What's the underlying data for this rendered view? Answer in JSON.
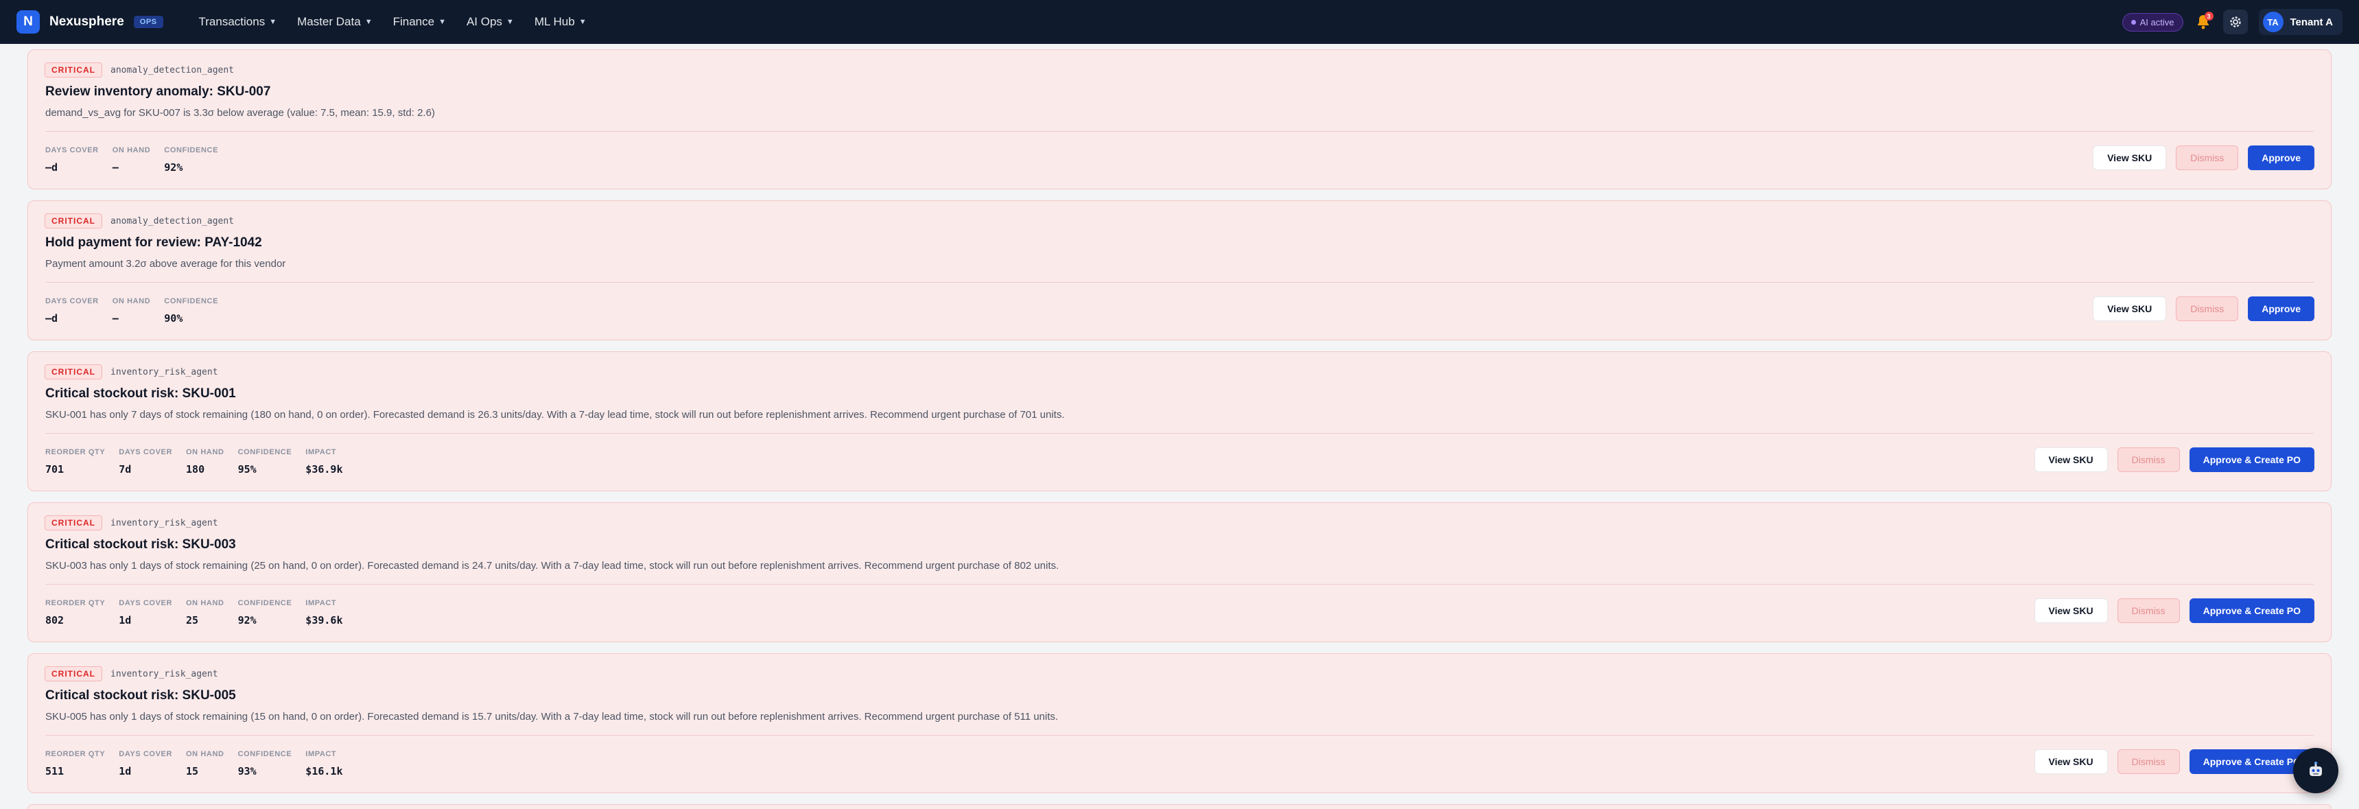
{
  "app": {
    "logo_letter": "N",
    "name": "Nexusphere",
    "env_badge": "OPS"
  },
  "nav": [
    {
      "label": "Transactions"
    },
    {
      "label": "Master Data"
    },
    {
      "label": "Finance"
    },
    {
      "label": "AI Ops"
    },
    {
      "label": "ML Hub"
    }
  ],
  "header_right": {
    "ai_status": "AI active",
    "notification_count": "3",
    "tenant_initials": "TA",
    "tenant_name": "Tenant A"
  },
  "cards": [
    {
      "severity": "CRITICAL",
      "agent": "anomaly_detection_agent",
      "title": "Review inventory anomaly: SKU-007",
      "description": "demand_vs_avg for SKU-007 is 3.3σ below average (value: 7.5, mean: 15.9, std: 2.6)",
      "metrics": [
        {
          "label": "DAYS COVER",
          "value": "—d"
        },
        {
          "label": "ON HAND",
          "value": "—"
        },
        {
          "label": "CONFIDENCE",
          "value": "92%"
        }
      ],
      "actions": {
        "view": "View SKU",
        "dismiss": "Dismiss",
        "approve": "Approve"
      }
    },
    {
      "severity": "CRITICAL",
      "agent": "anomaly_detection_agent",
      "title": "Hold payment for review: PAY-1042",
      "description": "Payment amount 3.2σ above average for this vendor",
      "metrics": [
        {
          "label": "DAYS COVER",
          "value": "—d"
        },
        {
          "label": "ON HAND",
          "value": "—"
        },
        {
          "label": "CONFIDENCE",
          "value": "90%"
        }
      ],
      "actions": {
        "view": "View SKU",
        "dismiss": "Dismiss",
        "approve": "Approve"
      }
    },
    {
      "severity": "CRITICAL",
      "agent": "inventory_risk_agent",
      "title": "Critical stockout risk: SKU-001",
      "description": "SKU-001 has only 7 days of stock remaining (180 on hand, 0 on order). Forecasted demand is 26.3 units/day. With a 7-day lead time, stock will run out before replenishment arrives. Recommend urgent purchase of 701 units.",
      "metrics": [
        {
          "label": "REORDER QTY",
          "value": "701"
        },
        {
          "label": "DAYS COVER",
          "value": "7d"
        },
        {
          "label": "ON HAND",
          "value": "180"
        },
        {
          "label": "CONFIDENCE",
          "value": "95%"
        },
        {
          "label": "IMPACT",
          "value": "$36.9k"
        }
      ],
      "actions": {
        "view": "View SKU",
        "dismiss": "Dismiss",
        "approve": "Approve & Create PO"
      }
    },
    {
      "severity": "CRITICAL",
      "agent": "inventory_risk_agent",
      "title": "Critical stockout risk: SKU-003",
      "description": "SKU-003 has only 1 days of stock remaining (25 on hand, 0 on order). Forecasted demand is 24.7 units/day. With a 7-day lead time, stock will run out before replenishment arrives. Recommend urgent purchase of 802 units.",
      "metrics": [
        {
          "label": "REORDER QTY",
          "value": "802"
        },
        {
          "label": "DAYS COVER",
          "value": "1d"
        },
        {
          "label": "ON HAND",
          "value": "25"
        },
        {
          "label": "CONFIDENCE",
          "value": "92%"
        },
        {
          "label": "IMPACT",
          "value": "$39.6k"
        }
      ],
      "actions": {
        "view": "View SKU",
        "dismiss": "Dismiss",
        "approve": "Approve & Create PO"
      }
    },
    {
      "severity": "CRITICAL",
      "agent": "inventory_risk_agent",
      "title": "Critical stockout risk: SKU-005",
      "description": "SKU-005 has only 1 days of stock remaining (15 on hand, 0 on order). Forecasted demand is 15.7 units/day. With a 7-day lead time, stock will run out before replenishment arrives. Recommend urgent purchase of 511 units.",
      "metrics": [
        {
          "label": "REORDER QTY",
          "value": "511"
        },
        {
          "label": "DAYS COVER",
          "value": "1d"
        },
        {
          "label": "ON HAND",
          "value": "15"
        },
        {
          "label": "CONFIDENCE",
          "value": "93%"
        },
        {
          "label": "IMPACT",
          "value": "$16.1k"
        }
      ],
      "actions": {
        "view": "View SKU",
        "dismiss": "Dismiss",
        "approve": "Approve & Create PO"
      }
    }
  ],
  "icons": {
    "bell": "bell-icon",
    "settings": "gear-icon",
    "assistant": "robot-icon"
  },
  "colors": {
    "nav_bg": "#0f1a2c",
    "accent": "#1d4ed8",
    "critical": "#dc2626",
    "card_bg": "#fbeaea"
  }
}
